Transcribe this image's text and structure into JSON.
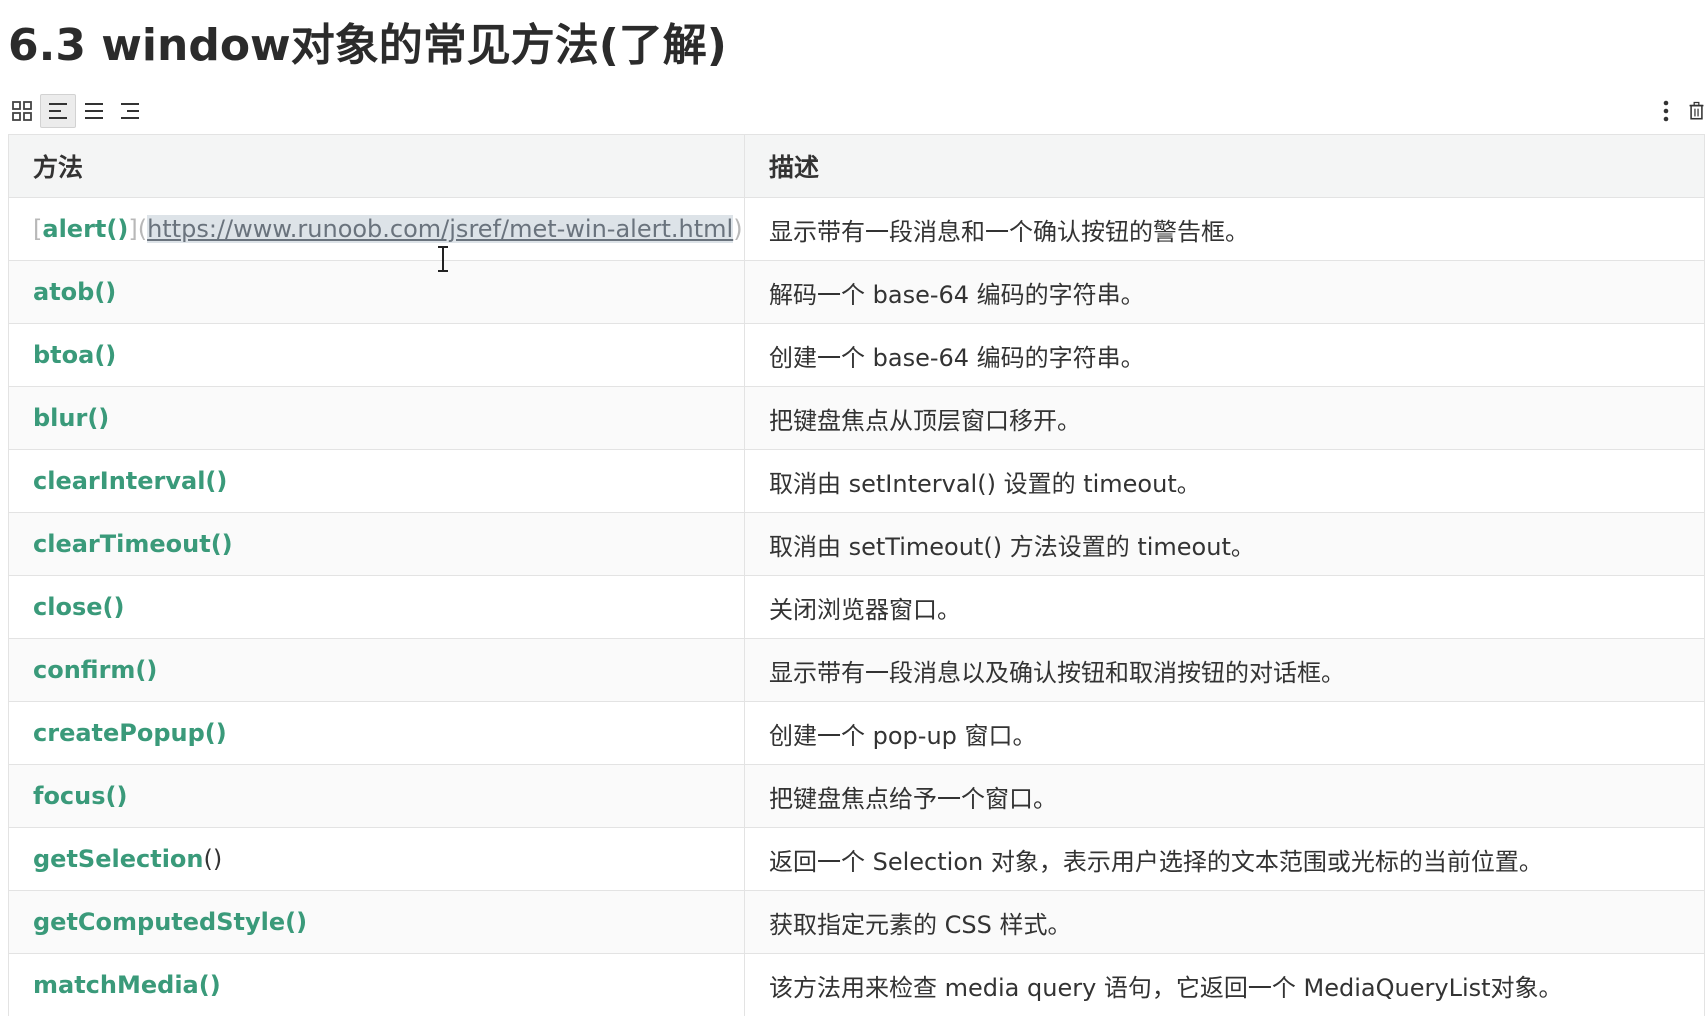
{
  "heading": "6.3 window对象的常见方法(了解)",
  "toolbar": {
    "buttons": [
      {
        "name": "grid-view",
        "active": false
      },
      {
        "name": "align-left",
        "active": true
      },
      {
        "name": "align-center",
        "active": false
      },
      {
        "name": "align-right",
        "active": false
      }
    ],
    "right_icons": [
      "more-vertical-icon",
      "delete-icon"
    ]
  },
  "table": {
    "headers": [
      "方法",
      "描述"
    ],
    "rows": [
      {
        "method": "alert()",
        "md_open": "[",
        "md_mid": "](",
        "link": "https://www.runoob.com/jsref/met-win-alert.html",
        "md_close": ")",
        "desc": "显示带有一段消息和一个确认按钮的警告框。"
      },
      {
        "method": "atob()",
        "desc": "解码一个 base-64 编码的字符串。"
      },
      {
        "method": "btoa()",
        "desc": "创建一个 base-64 编码的字符串。"
      },
      {
        "method": "blur()",
        "desc": "把键盘焦点从顶层窗口移开。"
      },
      {
        "method": "clearInterval()",
        "desc": "取消由 setInterval() 设置的 timeout。"
      },
      {
        "method": "clearTimeout()",
        "desc": "取消由 setTimeout() 方法设置的 timeout。"
      },
      {
        "method": "close()",
        "desc": "关闭浏览器窗口。"
      },
      {
        "method": "confirm()",
        "desc": "显示带有一段消息以及确认按钮和取消按钮的对话框。"
      },
      {
        "method": "createPopup()",
        "desc": "创建一个 pop-up 窗口。"
      },
      {
        "method": "focus()",
        "desc": "把键盘焦点给予一个窗口。"
      },
      {
        "method": "getSelection",
        "method_rest": "()",
        "desc": "返回一个 Selection 对象，表示用户选择的文本范围或光标的当前位置。"
      },
      {
        "method": "getComputedStyle()",
        "desc": "获取指定元素的 CSS 样式。"
      },
      {
        "method": "matchMedia()",
        "desc": "该方法用来检查 media query 语句，它返回一个 MediaQueryList对象。"
      }
    ]
  },
  "colors": {
    "method_link": "#3a9a7a",
    "header_bg": "#f4f5f5",
    "border": "#e3e3e3"
  }
}
